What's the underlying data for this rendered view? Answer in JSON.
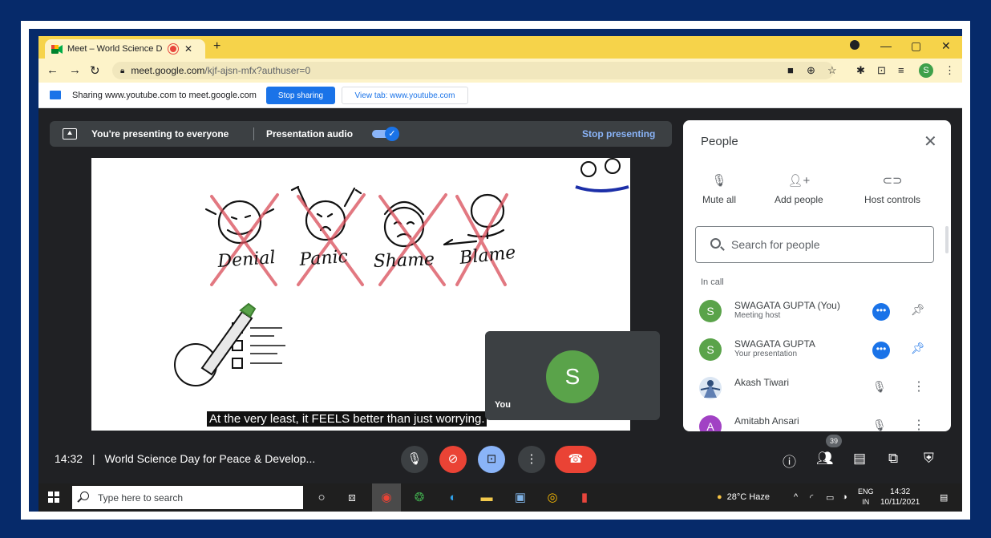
{
  "browser": {
    "tab_title": "Meet – World Science Day fo",
    "tab_close": "✕",
    "new_tab": "+",
    "url_host": "meet.google.com",
    "url_path": "/kjf-ajsn-mfx?authuser=0",
    "profile_initial": "S"
  },
  "sharebar": {
    "text": "Sharing www.youtube.com to meet.google.com",
    "stop_label": "Stop sharing",
    "view_tab_label": "View tab: www.youtube.com"
  },
  "presenting": {
    "text": "You're presenting to everyone",
    "audio_label": "Presentation audio",
    "audio_on": true,
    "stop_label": "Stop presenting"
  },
  "slide": {
    "words": [
      "Denial",
      "Panic",
      "Shame",
      "Blame"
    ],
    "caption": "At the very least, it FEELS better than just worrying."
  },
  "self_view": {
    "initial": "S",
    "label": "You"
  },
  "people_panel": {
    "title": "People",
    "actions": [
      {
        "label": "Mute all",
        "icon": "mic-off-icon"
      },
      {
        "label": "Add people",
        "icon": "add-person-icon"
      },
      {
        "label": "Host controls",
        "icon": "toggle-icon"
      }
    ],
    "search_placeholder": "Search for people",
    "section_label": "In call",
    "participants": [
      {
        "name": "SWAGATA GUPTA (You)",
        "subtitle": "Meeting host",
        "initial": "S",
        "color": "#5aa34a"
      },
      {
        "name": "SWAGATA GUPTA",
        "subtitle": "Your presentation",
        "initial": "S",
        "color": "#5aa34a"
      },
      {
        "name": "Akash Tiwari",
        "subtitle": "",
        "initial": "",
        "color": "#7fa1c9"
      },
      {
        "name": "Amitabh Ansari",
        "subtitle": "",
        "initial": "A",
        "color": "#a142c4"
      }
    ]
  },
  "meeting_bar": {
    "time": "14:32",
    "separator": "|",
    "title": "World Science Day for Peace & Develop...",
    "participant_count": "39"
  },
  "taskbar": {
    "search_placeholder": "Type here to search",
    "weather": "28°C  Haze",
    "lang_top": "ENG",
    "lang_bottom": "IN",
    "clock_time": "14:32",
    "clock_date": "10/11/2021"
  },
  "colors": {
    "frame_navy": "#062a6a",
    "meet_dark": "#202124",
    "chrome_yellow": "#f6d34a",
    "accent_blue": "#1a73e8",
    "end_call_red": "#ea4335"
  }
}
